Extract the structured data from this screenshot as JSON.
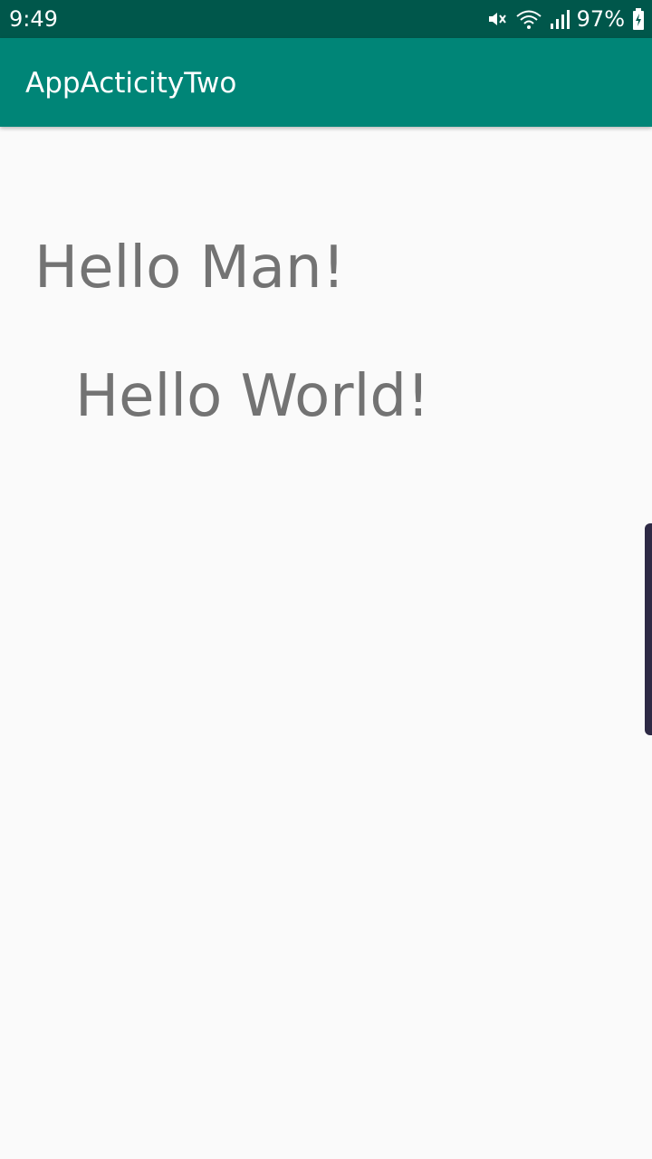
{
  "status_bar": {
    "time": "9:49",
    "battery": "97%",
    "icons": [
      "mute-icon",
      "wifi-icon",
      "signal-icon",
      "battery-charging-icon"
    ],
    "background": "#00574b"
  },
  "app_bar": {
    "title": "AppActicityTwo",
    "background": "#008577"
  },
  "main": {
    "text1": "Hello Man!",
    "text2": "Hello World!",
    "text_color": "#737373",
    "background": "#fafafa"
  }
}
